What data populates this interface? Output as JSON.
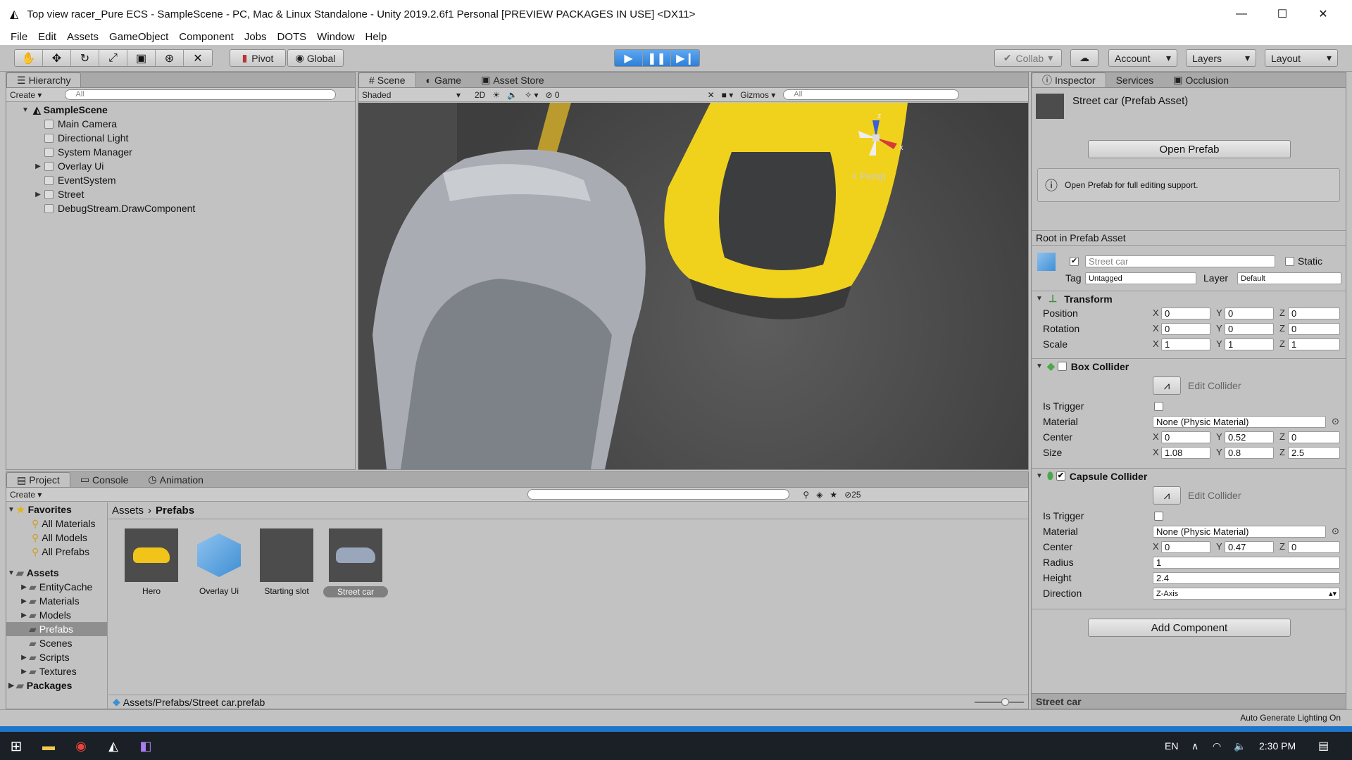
{
  "window": {
    "title": "Top view racer_Pure ECS - SampleScene - PC, Mac & Linux Standalone - Unity 2019.2.6f1 Personal [PREVIEW PACKAGES IN USE] <DX11>"
  },
  "menu": [
    "File",
    "Edit",
    "Assets",
    "GameObject",
    "Component",
    "Jobs",
    "DOTS",
    "Window",
    "Help"
  ],
  "toolbar": {
    "pivot": "Pivot",
    "global": "Global",
    "collab": "Collab",
    "account": "Account",
    "layers": "Layers",
    "layout": "Layout"
  },
  "hierarchy": {
    "tab": "Hierarchy",
    "create": "Create",
    "search_placeholder": "All",
    "scene": "SampleScene",
    "items": [
      "Main Camera",
      "Directional Light",
      "System Manager",
      "Overlay Ui",
      "EventSystem",
      "Street",
      "DebugStream.DrawComponent"
    ]
  },
  "scene_view": {
    "tabs": [
      "Scene",
      "Game",
      "Asset Store"
    ],
    "shading": "Shaded",
    "mode2d": "2D",
    "gizmos": "Gizmos",
    "search_placeholder": "All",
    "hidden_count": "0",
    "persp": "Persp",
    "axis_x": "x",
    "axis_z": "z"
  },
  "project": {
    "tabs": [
      "Project",
      "Console",
      "Animation"
    ],
    "create": "Create",
    "hidden_count": "25",
    "favorites_label": "Favorites",
    "favorites": [
      "All Materials",
      "All Models",
      "All Prefabs"
    ],
    "assets_label": "Assets",
    "folders": [
      "EntityCache",
      "Materials",
      "Models",
      "Prefabs",
      "Scenes",
      "Scripts",
      "Textures"
    ],
    "packages_label": "Packages",
    "breadcrumb": [
      "Assets",
      "Prefabs"
    ],
    "items": [
      "Hero",
      "Overlay Ui",
      "Starting slot",
      "Street car"
    ],
    "status_path": "Assets/Prefabs/Street car.prefab"
  },
  "inspector": {
    "tabs": [
      "Inspector",
      "Services",
      "Occlusion"
    ],
    "asset_title": "Street car (Prefab Asset)",
    "open_prefab": "Open Prefab",
    "info": "Open Prefab for full editing support.",
    "root_label": "Root in Prefab Asset",
    "name": "Street car",
    "static": "Static",
    "tag_label": "Tag",
    "tag": "Untagged",
    "layer_label": "Layer",
    "layer": "Default",
    "transform": {
      "title": "Transform",
      "position": [
        "0",
        "0",
        "0"
      ],
      "rotation": [
        "0",
        "0",
        "0"
      ],
      "scale": [
        "1",
        "1",
        "1"
      ],
      "labels": [
        "Position",
        "Rotation",
        "Scale"
      ]
    },
    "box": {
      "title": "Box Collider",
      "edit": "Edit Collider",
      "is_trigger": "Is Trigger",
      "material_label": "Material",
      "material": "None (Physic Material)",
      "center_label": "Center",
      "center": [
        "0",
        "0.52",
        "0"
      ],
      "size_label": "Size",
      "size": [
        "1.08",
        "0.8",
        "2.5"
      ]
    },
    "capsule": {
      "title": "Capsule Collider",
      "edit": "Edit Collider",
      "is_trigger": "Is Trigger",
      "material_label": "Material",
      "material": "None (Physic Material)",
      "center_label": "Center",
      "center": [
        "0",
        "0.47",
        "0"
      ],
      "radius_label": "Radius",
      "radius": "1",
      "height_label": "Height",
      "height": "2.4",
      "direction_label": "Direction",
      "direction": "Z-Axis"
    },
    "add_component": "Add Component",
    "preview_label": "Street car"
  },
  "status": {
    "lighting": "Auto Generate Lighting On"
  },
  "taskbar": {
    "lang": "EN",
    "time": "2:30 PM"
  }
}
